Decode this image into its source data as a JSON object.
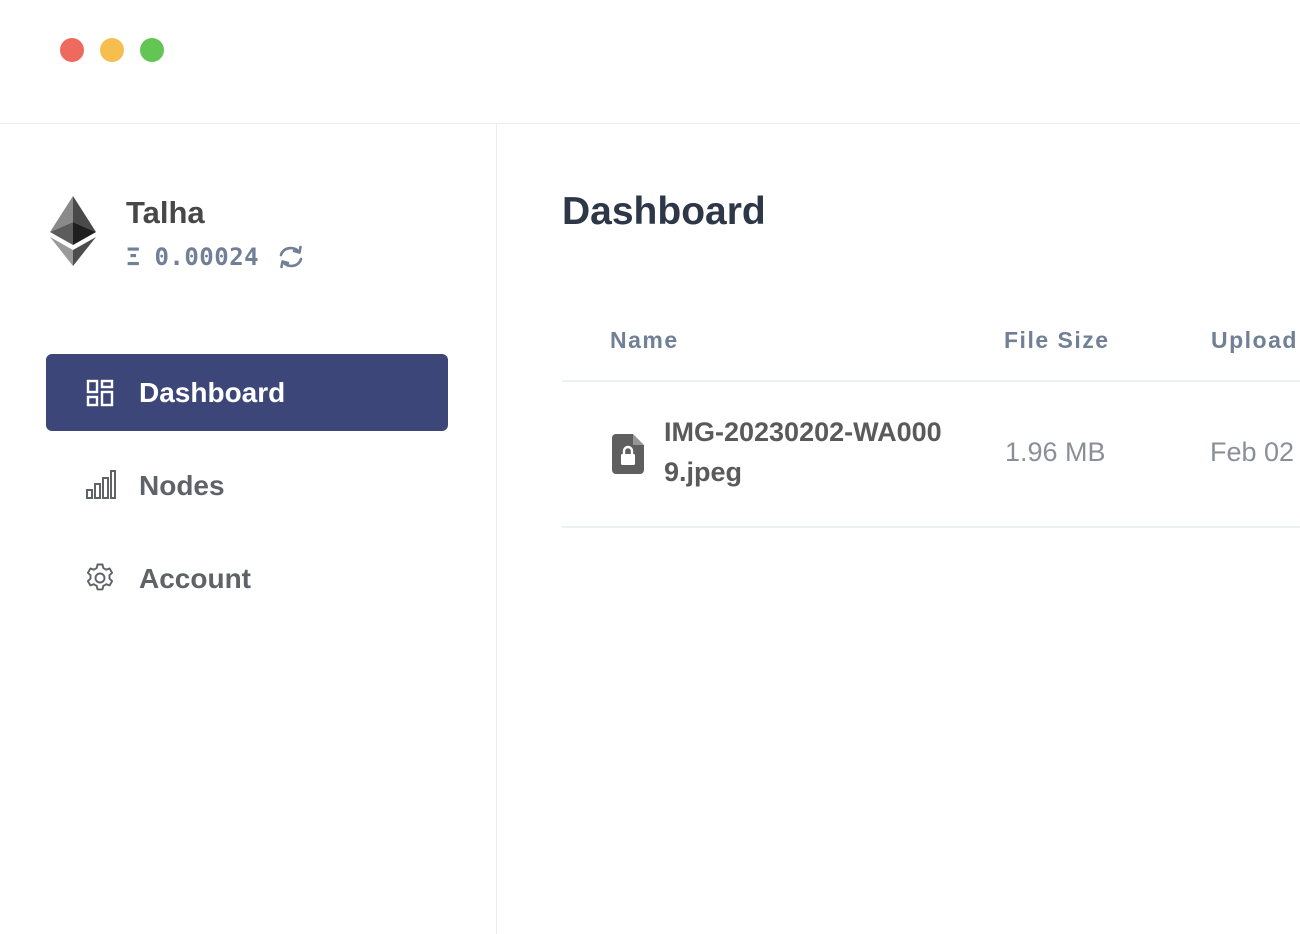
{
  "window": {
    "controls": {
      "close_color": "#ee6a5f",
      "minimize_color": "#f5be4f",
      "maximize_color": "#62c554"
    }
  },
  "sidebar": {
    "profile": {
      "logo_icon": "ethereum-icon",
      "name": "Talha",
      "currency_symbol": "Ξ",
      "balance": "0.00024",
      "refresh_icon": "refresh-icon"
    },
    "nav": [
      {
        "label": "Dashboard",
        "icon": "dashboard-grid-icon",
        "active": true
      },
      {
        "label": "Nodes",
        "icon": "bar-chart-icon",
        "active": false
      },
      {
        "label": "Account",
        "icon": "gear-icon",
        "active": false
      }
    ],
    "active_color": "#3d4679"
  },
  "main": {
    "title": "Dashboard",
    "table": {
      "columns": [
        "Name",
        "File Size",
        "Upload"
      ],
      "rows": [
        {
          "icon": "locked-file-icon",
          "name": "IMG-20230202-WA0009.jpeg",
          "size": "1.96 MB",
          "uploaded": "Feb 02"
        }
      ]
    }
  }
}
